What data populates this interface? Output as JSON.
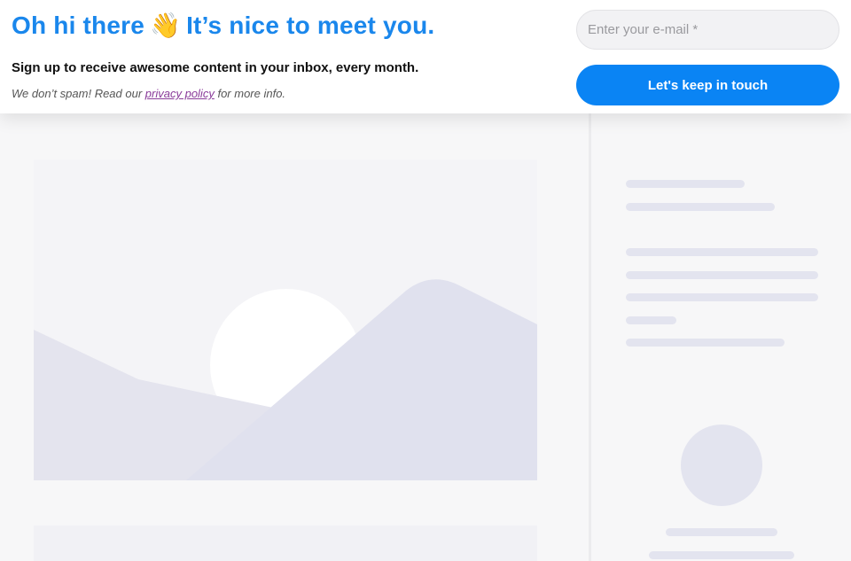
{
  "banner": {
    "headline_before": "Oh hi there",
    "wave_emoji": "👋",
    "headline_after": "It’s nice to meet you.",
    "subline": "Sign up to receive awesome content in your inbox, every month.",
    "note_before": "We don’t spam! Read our",
    "note_link": "privacy policy",
    "note_after": "for more info.",
    "email_placeholder": "Enter your e-mail *",
    "button_label": "Let's keep in touch"
  },
  "colors": {
    "accent": "#1a87ec",
    "button": "#0a84f4",
    "link": "#8a3c9a",
    "skeleton": "#e3e4ef"
  }
}
